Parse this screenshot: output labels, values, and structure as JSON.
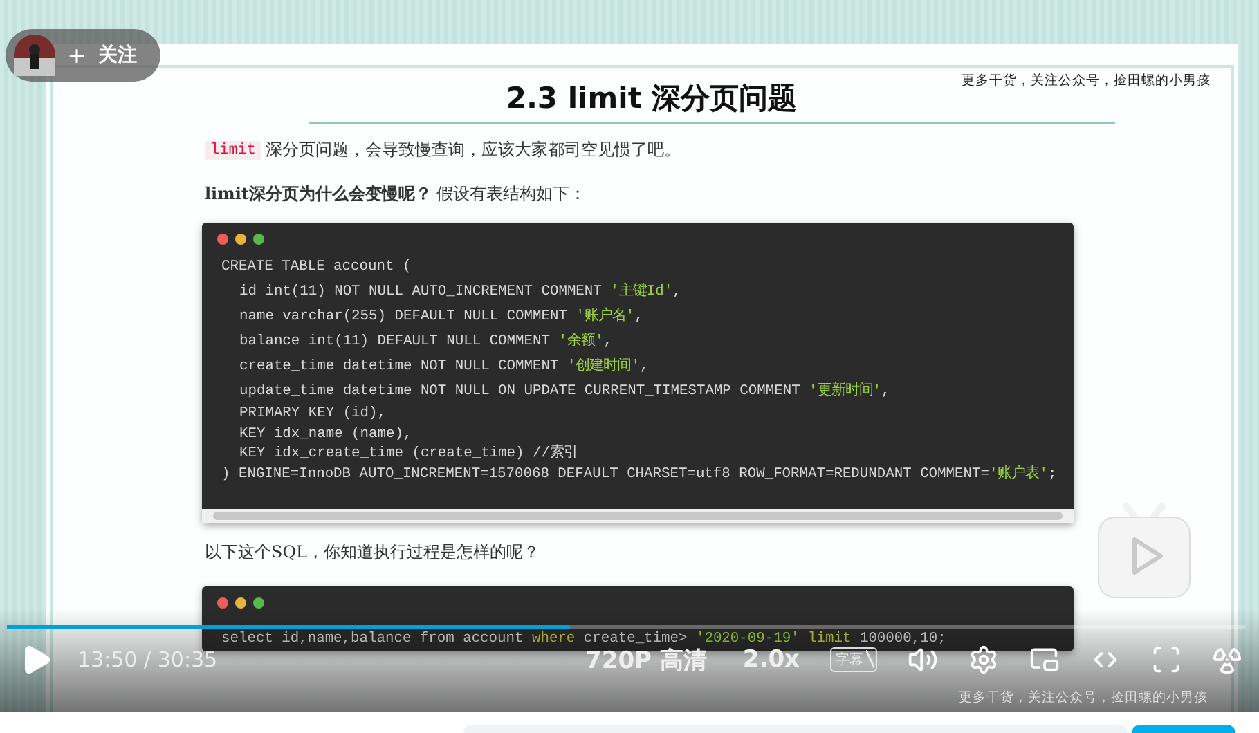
{
  "uploader": {
    "follow_label": "关注"
  },
  "captions": [
    "更多干货，关注公众号，捡田螺的小男孩",
    "更多干货，关注公众号，捡田螺的小男孩"
  ],
  "slide": {
    "title": "2.3 limit 深分页问题",
    "intro_code": "limit",
    "intro_text": "深分页问题，会导致慢查询，应该大家都司空见惯了吧。",
    "question": "**limit深分页为什么会变慢呢？** 假设有表结构如下：",
    "between_text": "以下这个SQL，你知道执行过程是怎样的呢？",
    "code_blocks": [
      {
        "scrollbar": true,
        "lines": [
          {
            "indent": false,
            "parts": [
              {
                "kind": "plain",
                "text": "CREATE TABLE account ("
              }
            ]
          },
          {
            "indent": true,
            "parts": [
              {
                "kind": "plain",
                "text": "id int(11) NOT NULL AUTO_INCREMENT COMMENT "
              },
              {
                "kind": "string",
                "text": "'主键Id'"
              },
              {
                "kind": "plain",
                "text": ","
              }
            ]
          },
          {
            "indent": true,
            "parts": [
              {
                "kind": "plain",
                "text": "name varchar(255) DEFAULT NULL COMMENT "
              },
              {
                "kind": "string",
                "text": "'账户名'"
              },
              {
                "kind": "plain",
                "text": ","
              }
            ]
          },
          {
            "indent": true,
            "parts": [
              {
                "kind": "plain",
                "text": "balance int(11) DEFAULT NULL COMMENT "
              },
              {
                "kind": "string",
                "text": "'余额'"
              },
              {
                "kind": "plain",
                "text": ","
              }
            ]
          },
          {
            "indent": true,
            "parts": [
              {
                "kind": "plain",
                "text": "create_time datetime NOT NULL COMMENT "
              },
              {
                "kind": "string",
                "text": "'创建时间'"
              },
              {
                "kind": "plain",
                "text": ","
              }
            ]
          },
          {
            "indent": true,
            "parts": [
              {
                "kind": "plain",
                "text": "update_time datetime NOT NULL ON UPDATE CURRENT_TIMESTAMP COMMENT "
              },
              {
                "kind": "string",
                "text": "'更新时间'"
              },
              {
                "kind": "plain",
                "text": ","
              }
            ]
          },
          {
            "indent": true,
            "parts": [
              {
                "kind": "plain",
                "text": "PRIMARY KEY (id),"
              }
            ]
          },
          {
            "indent": true,
            "parts": [
              {
                "kind": "plain",
                "text": "KEY idx_name (name),"
              }
            ]
          },
          {
            "indent": true,
            "parts": [
              {
                "kind": "plain",
                "text": "KEY idx_create_time (create_time) //索引"
              }
            ]
          },
          {
            "indent": false,
            "parts": [
              {
                "kind": "plain",
                "text": ") ENGINE=InnoDB AUTO_INCREMENT=1570068 DEFAULT CHARSET=utf8 ROW_FORMAT=REDUNDANT COMMENT="
              },
              {
                "kind": "string",
                "text": "'账户表'"
              },
              {
                "kind": "plain",
                "text": ";"
              }
            ]
          }
        ]
      },
      {
        "scrollbar": false,
        "lines": [
          {
            "indent": false,
            "parts": [
              {
                "kind": "plain",
                "text": "select id,name,balance from account "
              },
              {
                "kind": "keyword",
                "text": "where"
              },
              {
                "kind": "plain",
                "text": " create_time> "
              },
              {
                "kind": "string",
                "text": "'2020-09-19'"
              },
              {
                "kind": "keyword",
                "text": " limit"
              },
              {
                "kind": "plain",
                "text": " 100000,10;"
              }
            ]
          }
        ]
      }
    ]
  },
  "player": {
    "playing": false,
    "level": 0.455,
    "time_current": "13:50",
    "time_separator": "/",
    "time_total": "30:35",
    "quality": "720P 高清",
    "speed": "2.0x",
    "subtitle_label": "字幕",
    "subtitles_on": false
  }
}
